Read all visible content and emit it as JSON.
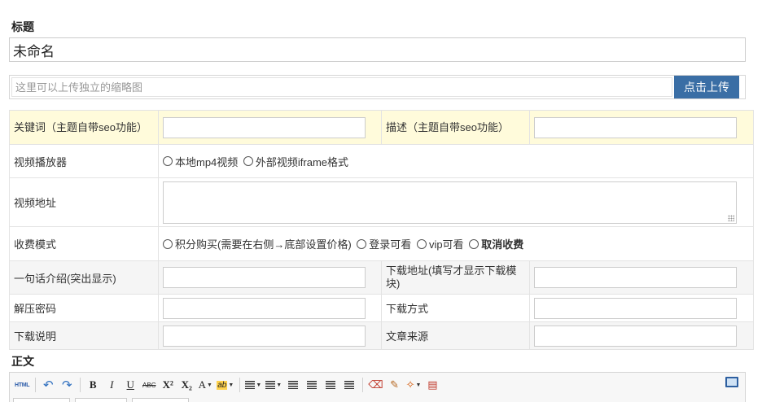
{
  "title_label": "标题",
  "title_value": "未命名",
  "thumbnail": {
    "placeholder": "这里可以上传独立的缩略图",
    "upload_label": "点击上传"
  },
  "fields": {
    "keywords_label": "关键词（主题自带seo功能）",
    "description_label": "描述（主题自带seo功能）",
    "player_label": "视频播放器",
    "player_options": [
      "本地mp4视频",
      "外部视频iframe格式"
    ],
    "video_url_label": "视频地址",
    "charge_label": "收费模式",
    "charge_options": [
      "积分购买(需要在右侧→底部设置价格)",
      "登录可看",
      "vip可看",
      "取消收费"
    ],
    "intro_label": "一句话介绍(突出显示)",
    "download_url_label": "下载地址(填写才显示下载模块)",
    "unzip_password_label": "解压密码",
    "download_method_label": "下载方式",
    "download_notes_label": "下载说明",
    "source_label": "文章来源"
  },
  "body_label": "正文",
  "toolbar": {
    "html": "HTML",
    "bold": "B",
    "italic": "I",
    "underline": "U",
    "strike": "ABC",
    "superscript": "X²",
    "subscript": "X₂",
    "font_color": "A",
    "highlight": "ab"
  }
}
